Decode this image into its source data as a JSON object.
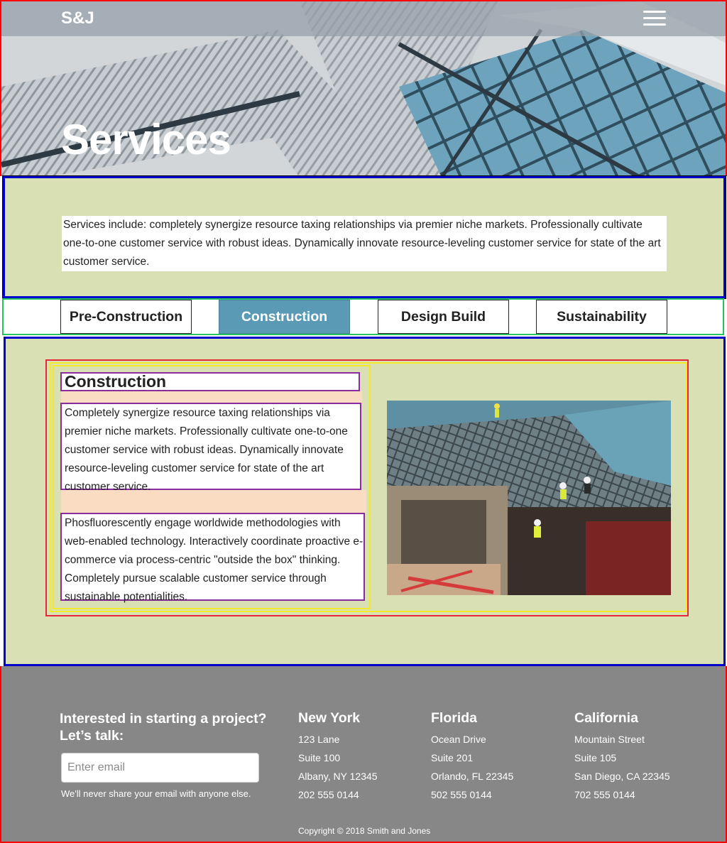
{
  "nav": {
    "brand": "S&J",
    "menu_icon": "hamburger-menu-icon"
  },
  "hero": {
    "title": "Services"
  },
  "intro": {
    "text": "Services include: completely synergize resource taxing relationships via premier niche markets. Professionally cultivate one-to-one customer service with robust ideas. Dynamically innovate resource-leveling customer service for state of the art customer service."
  },
  "tabs": [
    {
      "label": "Pre-Construction",
      "active": false
    },
    {
      "label": "Construction",
      "active": true
    },
    {
      "label": "Design Build",
      "active": false
    },
    {
      "label": "Sustainability",
      "active": false
    }
  ],
  "section": {
    "title": "Construction",
    "paragraphs": [
      "Completely synergize resource taxing relationships via premier niche markets. Professionally cultivate one-to-one customer service with robust ideas. Dynamically innovate resource-leveling customer service for state of the art customer service.",
      "Phosfluorescently engage worldwide methodologies with web-enabled technology. Interactively coordinate proactive e-commerce via process-centric \"outside the box\" thinking. Completely pursue scalable customer service through sustainable potentialities."
    ]
  },
  "footer": {
    "cta_title": "Interested in starting a project? Let’s talk:",
    "email_placeholder": "Enter email",
    "email_help": "We'll never share your email with anyone else.",
    "offices": [
      {
        "city": "New York",
        "lines": [
          "123 Lane",
          "Suite 100",
          "Albany, NY 12345",
          "202 555 0144"
        ]
      },
      {
        "city": "Florida",
        "lines": [
          "Ocean Drive",
          "Suite 201",
          "Orlando, FL 22345",
          "502 555 0144"
        ]
      },
      {
        "city": "California",
        "lines": [
          "Mountain Street",
          "Suite 105",
          "San Diego, CA 22345",
          "702 555 0144"
        ]
      }
    ],
    "copyright": "Copyright © 2018 Smith and Jones"
  },
  "colors": {
    "content_bg": "#d9e0b4",
    "active_tab": "#5a9ab5",
    "footer_bg": "#878787"
  }
}
